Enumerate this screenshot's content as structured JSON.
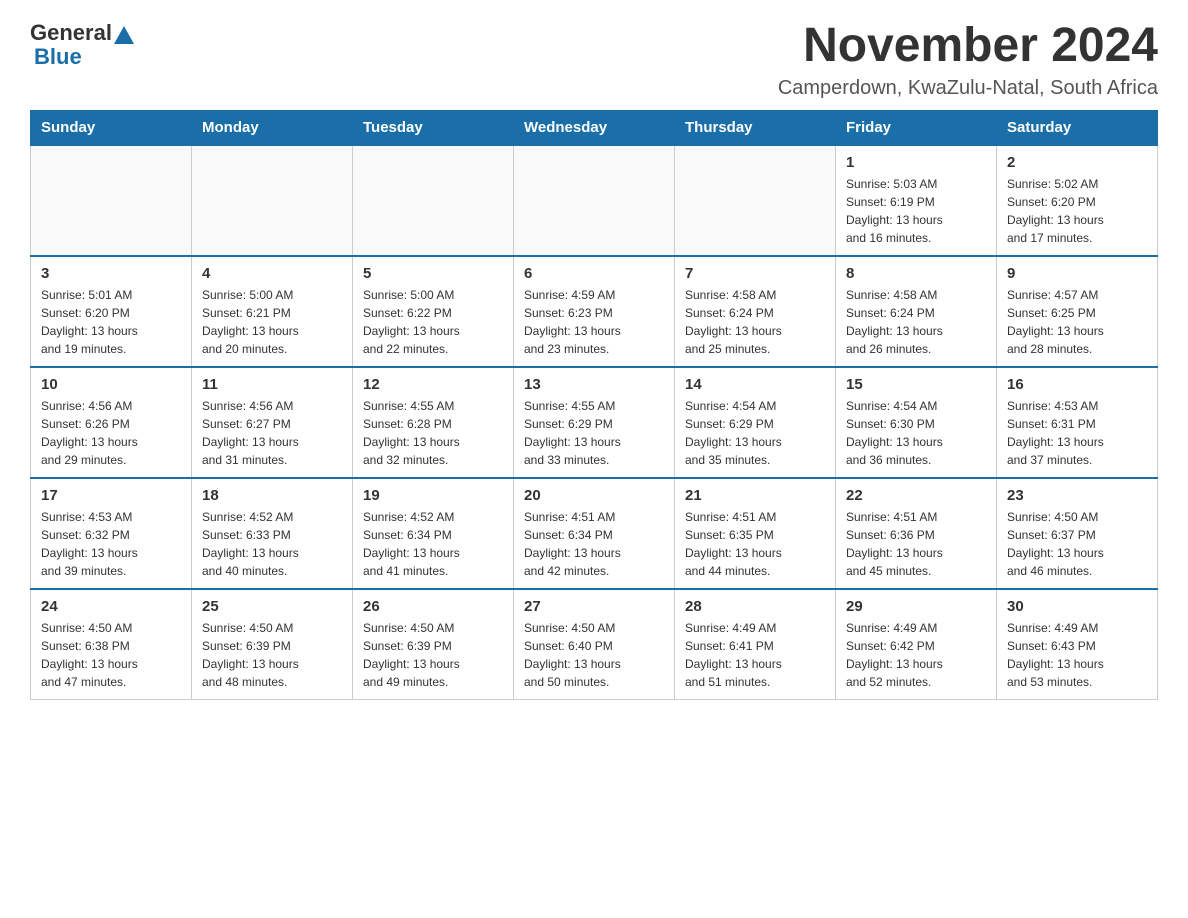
{
  "header": {
    "logo_general": "General",
    "logo_blue": "Blue",
    "title": "November 2024",
    "subtitle": "Camperdown, KwaZulu-Natal, South Africa"
  },
  "weekdays": [
    "Sunday",
    "Monday",
    "Tuesday",
    "Wednesday",
    "Thursday",
    "Friday",
    "Saturday"
  ],
  "weeks": [
    {
      "days": [
        {
          "num": "",
          "info": ""
        },
        {
          "num": "",
          "info": ""
        },
        {
          "num": "",
          "info": ""
        },
        {
          "num": "",
          "info": ""
        },
        {
          "num": "",
          "info": ""
        },
        {
          "num": "1",
          "info": "Sunrise: 5:03 AM\nSunset: 6:19 PM\nDaylight: 13 hours\nand 16 minutes."
        },
        {
          "num": "2",
          "info": "Sunrise: 5:02 AM\nSunset: 6:20 PM\nDaylight: 13 hours\nand 17 minutes."
        }
      ]
    },
    {
      "days": [
        {
          "num": "3",
          "info": "Sunrise: 5:01 AM\nSunset: 6:20 PM\nDaylight: 13 hours\nand 19 minutes."
        },
        {
          "num": "4",
          "info": "Sunrise: 5:00 AM\nSunset: 6:21 PM\nDaylight: 13 hours\nand 20 minutes."
        },
        {
          "num": "5",
          "info": "Sunrise: 5:00 AM\nSunset: 6:22 PM\nDaylight: 13 hours\nand 22 minutes."
        },
        {
          "num": "6",
          "info": "Sunrise: 4:59 AM\nSunset: 6:23 PM\nDaylight: 13 hours\nand 23 minutes."
        },
        {
          "num": "7",
          "info": "Sunrise: 4:58 AM\nSunset: 6:24 PM\nDaylight: 13 hours\nand 25 minutes."
        },
        {
          "num": "8",
          "info": "Sunrise: 4:58 AM\nSunset: 6:24 PM\nDaylight: 13 hours\nand 26 minutes."
        },
        {
          "num": "9",
          "info": "Sunrise: 4:57 AM\nSunset: 6:25 PM\nDaylight: 13 hours\nand 28 minutes."
        }
      ]
    },
    {
      "days": [
        {
          "num": "10",
          "info": "Sunrise: 4:56 AM\nSunset: 6:26 PM\nDaylight: 13 hours\nand 29 minutes."
        },
        {
          "num": "11",
          "info": "Sunrise: 4:56 AM\nSunset: 6:27 PM\nDaylight: 13 hours\nand 31 minutes."
        },
        {
          "num": "12",
          "info": "Sunrise: 4:55 AM\nSunset: 6:28 PM\nDaylight: 13 hours\nand 32 minutes."
        },
        {
          "num": "13",
          "info": "Sunrise: 4:55 AM\nSunset: 6:29 PM\nDaylight: 13 hours\nand 33 minutes."
        },
        {
          "num": "14",
          "info": "Sunrise: 4:54 AM\nSunset: 6:29 PM\nDaylight: 13 hours\nand 35 minutes."
        },
        {
          "num": "15",
          "info": "Sunrise: 4:54 AM\nSunset: 6:30 PM\nDaylight: 13 hours\nand 36 minutes."
        },
        {
          "num": "16",
          "info": "Sunrise: 4:53 AM\nSunset: 6:31 PM\nDaylight: 13 hours\nand 37 minutes."
        }
      ]
    },
    {
      "days": [
        {
          "num": "17",
          "info": "Sunrise: 4:53 AM\nSunset: 6:32 PM\nDaylight: 13 hours\nand 39 minutes."
        },
        {
          "num": "18",
          "info": "Sunrise: 4:52 AM\nSunset: 6:33 PM\nDaylight: 13 hours\nand 40 minutes."
        },
        {
          "num": "19",
          "info": "Sunrise: 4:52 AM\nSunset: 6:34 PM\nDaylight: 13 hours\nand 41 minutes."
        },
        {
          "num": "20",
          "info": "Sunrise: 4:51 AM\nSunset: 6:34 PM\nDaylight: 13 hours\nand 42 minutes."
        },
        {
          "num": "21",
          "info": "Sunrise: 4:51 AM\nSunset: 6:35 PM\nDaylight: 13 hours\nand 44 minutes."
        },
        {
          "num": "22",
          "info": "Sunrise: 4:51 AM\nSunset: 6:36 PM\nDaylight: 13 hours\nand 45 minutes."
        },
        {
          "num": "23",
          "info": "Sunrise: 4:50 AM\nSunset: 6:37 PM\nDaylight: 13 hours\nand 46 minutes."
        }
      ]
    },
    {
      "days": [
        {
          "num": "24",
          "info": "Sunrise: 4:50 AM\nSunset: 6:38 PM\nDaylight: 13 hours\nand 47 minutes."
        },
        {
          "num": "25",
          "info": "Sunrise: 4:50 AM\nSunset: 6:39 PM\nDaylight: 13 hours\nand 48 minutes."
        },
        {
          "num": "26",
          "info": "Sunrise: 4:50 AM\nSunset: 6:39 PM\nDaylight: 13 hours\nand 49 minutes."
        },
        {
          "num": "27",
          "info": "Sunrise: 4:50 AM\nSunset: 6:40 PM\nDaylight: 13 hours\nand 50 minutes."
        },
        {
          "num": "28",
          "info": "Sunrise: 4:49 AM\nSunset: 6:41 PM\nDaylight: 13 hours\nand 51 minutes."
        },
        {
          "num": "29",
          "info": "Sunrise: 4:49 AM\nSunset: 6:42 PM\nDaylight: 13 hours\nand 52 minutes."
        },
        {
          "num": "30",
          "info": "Sunrise: 4:49 AM\nSunset: 6:43 PM\nDaylight: 13 hours\nand 53 minutes."
        }
      ]
    }
  ]
}
